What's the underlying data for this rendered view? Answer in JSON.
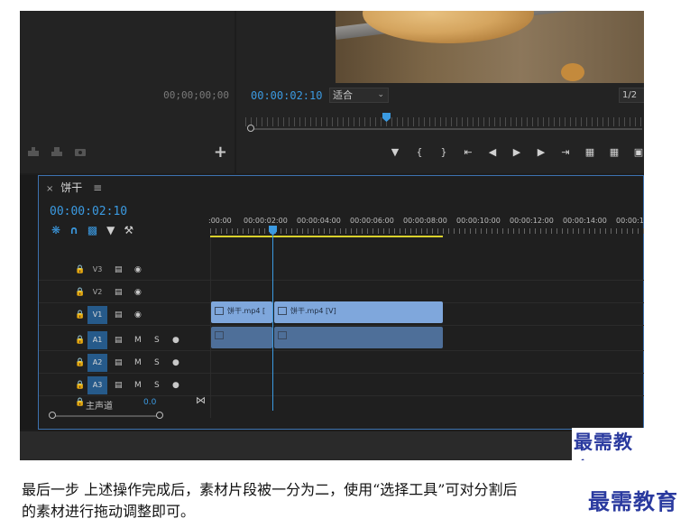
{
  "source_monitor": {
    "timecode": "00;00;00;00",
    "add_button": "+"
  },
  "program_monitor": {
    "timecode": "00:00:02:10",
    "fit": "适合",
    "resolution": "1/2"
  },
  "timeline": {
    "sequence_name": "饼干",
    "close_icon": "×",
    "menu_icon": "≡",
    "timecode": "00:00:02:10",
    "ruler": ":00:00",
    "r1": "00:00:02:00",
    "r2": "00:00:04:00",
    "r3": "00:00:06:00",
    "r4": "00:00:08:00",
    "r5": "00:00:10:00",
    "r6": "00:00:12:00",
    "r7": "00:00:14:00",
    "r8": "00:00:1",
    "tracks": {
      "v3": "V3",
      "v2": "V2",
      "v1": "V1",
      "a1": "A1",
      "a2": "A2",
      "a3": "A3",
      "m": "M",
      "s": "S"
    },
    "master": "主声道",
    "master_value": "0.0",
    "clip_v1_left": "饼干.mp4 [",
    "clip_v1_right": "饼干.mp4 [V]"
  },
  "watermark_inner": "最需教育",
  "caption_line1": "最后一步  上述操作完成后，素材片段被一分为二，使用“选择工具”可对分割后",
  "caption_line2": "的素材进行拖动调整即可。",
  "watermark_outer": "最需教育",
  "colors": {
    "accent": "#3b9ae1",
    "clip_video": "#7fa7dc",
    "clip_audio": "#4e6f99",
    "work_area": "#d9d12c",
    "watermark": "#2a3a9f"
  }
}
